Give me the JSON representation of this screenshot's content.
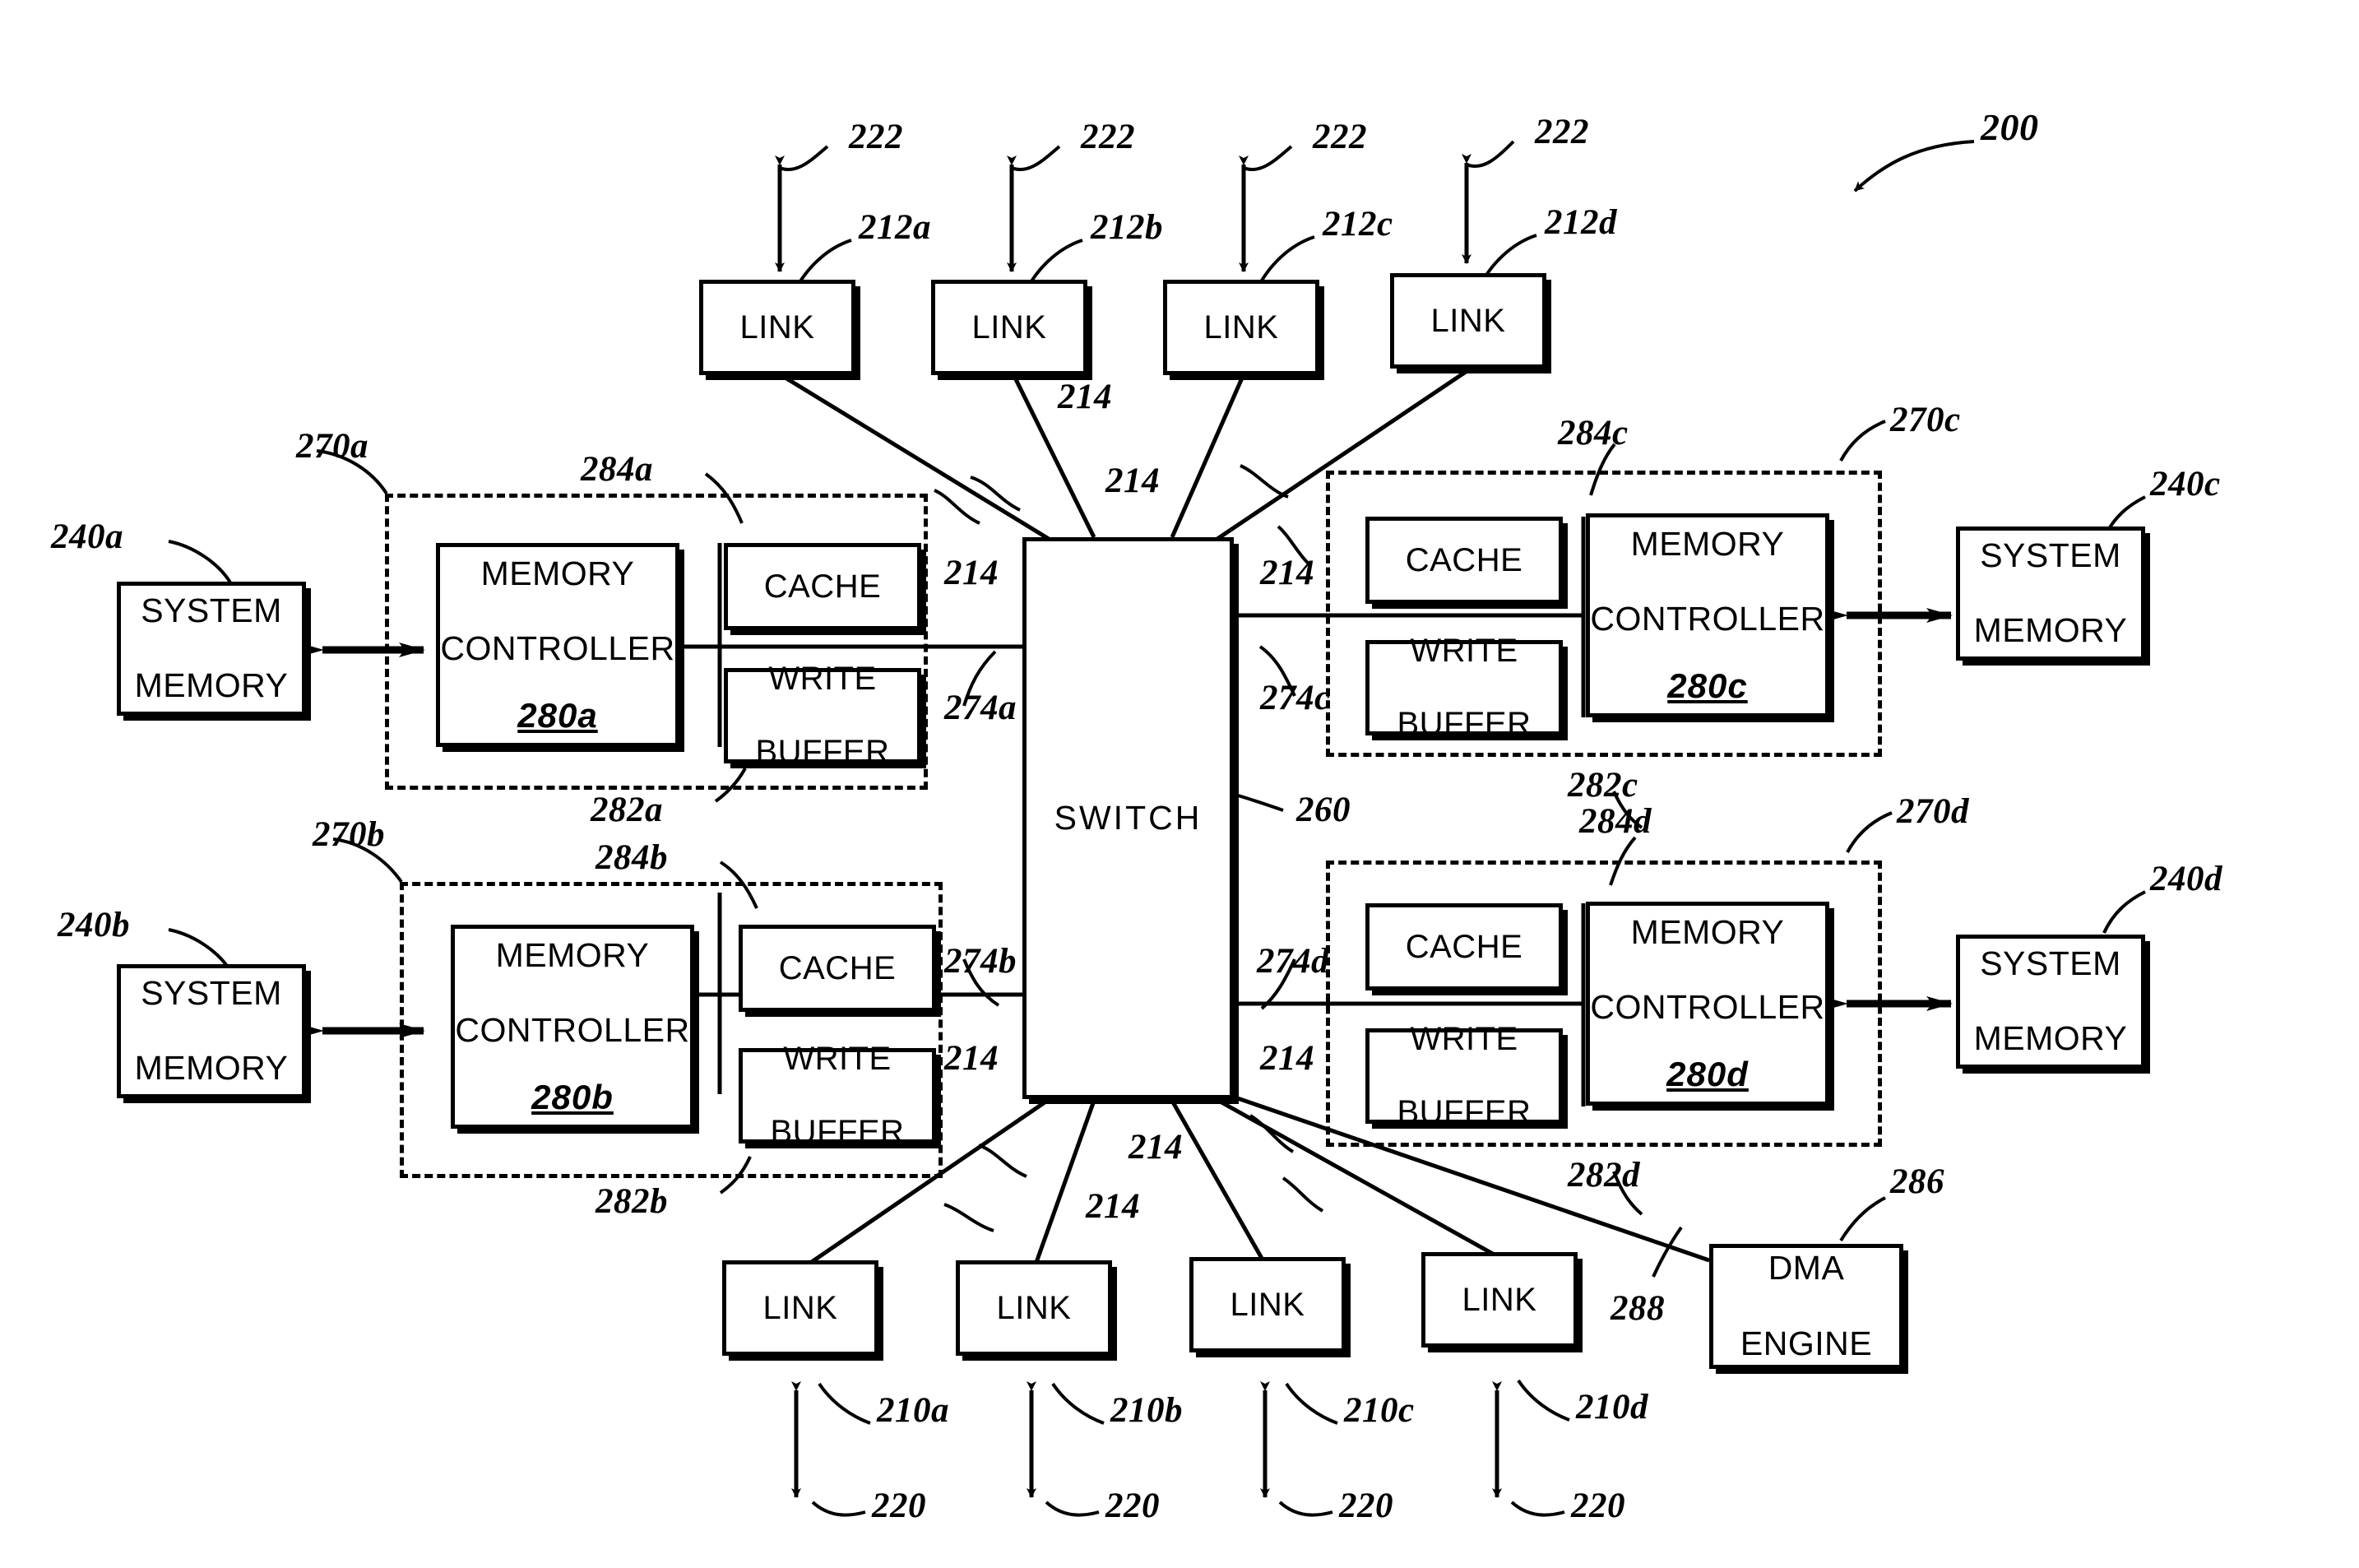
{
  "figure": {
    "system_ref": "200",
    "switch_label": "SWITCH",
    "switch_ref": "260",
    "dma_label_line1": "DMA",
    "dma_label_line2": "ENGINE",
    "dma_ref": "286",
    "dma_link_ref": "288",
    "link_label": "LINK",
    "cache_label": "CACHE",
    "write_buffer_line1": "WRITE",
    "write_buffer_line2": "BUFFER",
    "memory_controller_line1": "MEMORY",
    "memory_controller_line2": "CONTROLLER",
    "system_memory_line1": "SYSTEM",
    "system_memory_line2": "MEMORY",
    "interconnect_ref": "214"
  },
  "top_links": [
    {
      "label": "LINK",
      "ref": "212a",
      "arrow_ref": "222"
    },
    {
      "label": "LINK",
      "ref": "212b",
      "arrow_ref": "222"
    },
    {
      "label": "LINK",
      "ref": "212c",
      "arrow_ref": "222"
    },
    {
      "label": "LINK",
      "ref": "212d",
      "arrow_ref": "222"
    }
  ],
  "bottom_links": [
    {
      "label": "LINK",
      "ref": "210a",
      "arrow_ref": "220"
    },
    {
      "label": "LINK",
      "ref": "210b",
      "arrow_ref": "220"
    },
    {
      "label": "LINK",
      "ref": "210c",
      "arrow_ref": "220"
    },
    {
      "label": "LINK",
      "ref": "210d",
      "arrow_ref": "220"
    }
  ],
  "nodes": [
    {
      "id": "a",
      "group_ref": "270a",
      "memory_controller_ref": "280a",
      "cache_ref": "284a",
      "write_buffer_ref": "282a",
      "port_ref": "274a",
      "system_memory_ref": "240a"
    },
    {
      "id": "b",
      "group_ref": "270b",
      "memory_controller_ref": "280b",
      "cache_ref": "284b",
      "write_buffer_ref": "282b",
      "port_ref": "274b",
      "system_memory_ref": "240b"
    },
    {
      "id": "c",
      "group_ref": "270c",
      "memory_controller_ref": "280c",
      "cache_ref": "284c",
      "write_buffer_ref": "282c",
      "port_ref": "274c",
      "system_memory_ref": "240c"
    },
    {
      "id": "d",
      "group_ref": "270d",
      "memory_controller_ref": "280d",
      "cache_ref": "284d",
      "write_buffer_ref": "282d",
      "port_ref": "274d",
      "system_memory_ref": "240d"
    }
  ],
  "interconnect_refs": {
    "top_left": "214",
    "top_mid_a": "214",
    "top_mid_b": "214",
    "top_right": "214",
    "bottom_left": "214",
    "bottom_mid_a": "214",
    "bottom_mid_b": "214",
    "bottom_right": "214"
  },
  "colors": {
    "ink": "#000000",
    "paper": "#ffffff"
  }
}
